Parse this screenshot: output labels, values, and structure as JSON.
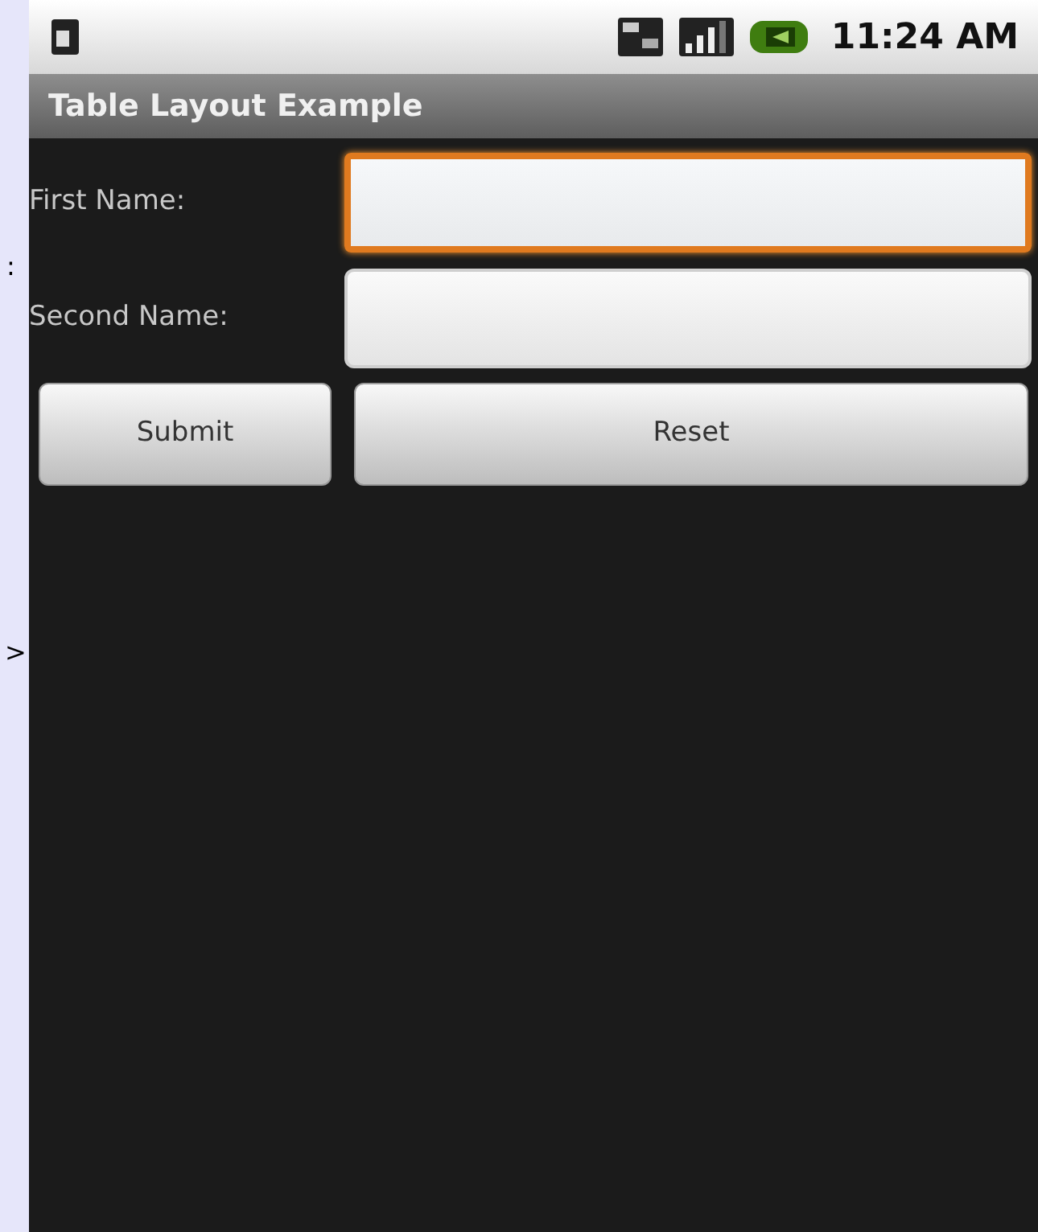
{
  "backdrop": {
    "marks": [
      ":",
      ">"
    ]
  },
  "status_bar": {
    "time": "11:24 AM"
  },
  "title_bar": {
    "title": "Table Layout Example"
  },
  "form": {
    "rows": [
      {
        "label": "First Name:",
        "focused": true
      },
      {
        "label": "Second Name:",
        "focused": false
      }
    ],
    "buttons": [
      "Submit",
      "Reset"
    ]
  }
}
